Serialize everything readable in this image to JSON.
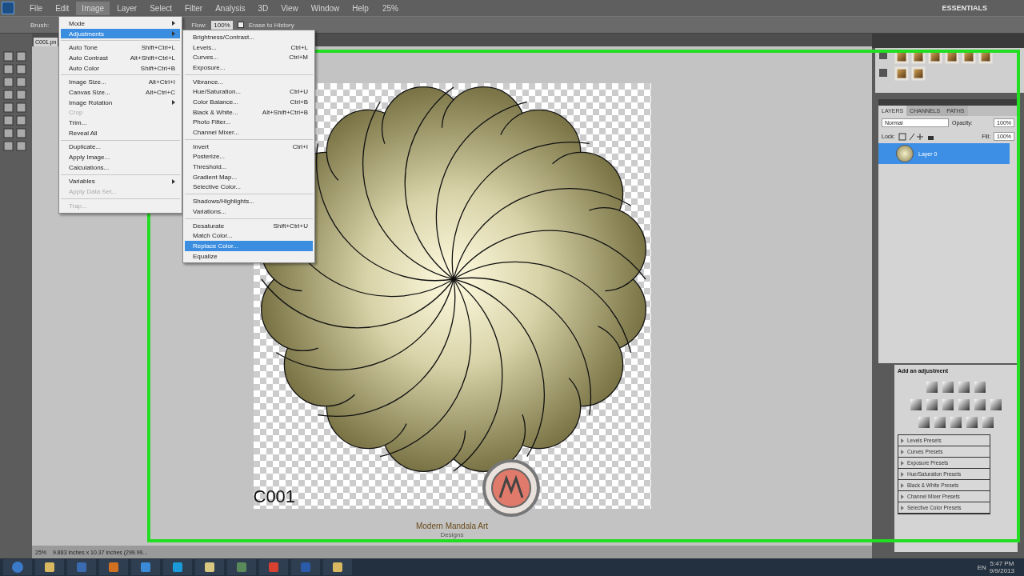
{
  "menu_bar": {
    "items": [
      {
        "label": "File",
        "selected": false
      },
      {
        "label": "Edit",
        "selected": false
      },
      {
        "label": "Image",
        "selected": true
      },
      {
        "label": "Layer",
        "selected": false
      },
      {
        "label": "Select",
        "selected": false
      },
      {
        "label": "Filter",
        "selected": false
      },
      {
        "label": "Analysis",
        "selected": false
      },
      {
        "label": "3D",
        "selected": false
      },
      {
        "label": "View",
        "selected": false
      },
      {
        "label": "Window",
        "selected": false
      },
      {
        "label": "Help",
        "selected": false
      }
    ],
    "zoom": "25%",
    "workspace": "ESSENTIALS"
  },
  "options_bar": {
    "brush_label": "Brush:",
    "flow_label": "Flow:",
    "flow_value": "100%",
    "erase_to_history": "Erase to History",
    "erase_to_history_checked": false
  },
  "image_menu": [
    {
      "kind": "submenu",
      "label": "Mode",
      "selected": false,
      "disabled": false
    },
    {
      "kind": "submenu",
      "label": "Adjustments",
      "selected": true,
      "disabled": false
    },
    {
      "kind": "separator"
    },
    {
      "kind": "item",
      "label": "Auto Tone",
      "shortcut": "Shift+Ctrl+L",
      "selected": false,
      "disabled": false
    },
    {
      "kind": "item",
      "label": "Auto Contrast",
      "shortcut": "Alt+Shift+Ctrl+L",
      "selected": false,
      "disabled": false
    },
    {
      "kind": "item",
      "label": "Auto Color",
      "shortcut": "Shift+Ctrl+B",
      "selected": false,
      "disabled": false
    },
    {
      "kind": "separator"
    },
    {
      "kind": "item",
      "label": "Image Size...",
      "shortcut": "Alt+Ctrl+I",
      "selected": false,
      "disabled": false
    },
    {
      "kind": "item",
      "label": "Canvas Size...",
      "shortcut": "Alt+Ctrl+C",
      "selected": false,
      "disabled": false
    },
    {
      "kind": "submenu",
      "label": "Image Rotation",
      "selected": false,
      "disabled": false
    },
    {
      "kind": "item",
      "label": "Crop",
      "selected": false,
      "disabled": true
    },
    {
      "kind": "item",
      "label": "Trim...",
      "selected": false,
      "disabled": false
    },
    {
      "kind": "item",
      "label": "Reveal All",
      "selected": false,
      "disabled": false
    },
    {
      "kind": "separator"
    },
    {
      "kind": "item",
      "label": "Duplicate...",
      "selected": false,
      "disabled": false
    },
    {
      "kind": "item",
      "label": "Apply Image...",
      "selected": false,
      "disabled": false
    },
    {
      "kind": "item",
      "label": "Calculations...",
      "selected": false,
      "disabled": false
    },
    {
      "kind": "separator"
    },
    {
      "kind": "submenu",
      "label": "Variables",
      "selected": false,
      "disabled": false
    },
    {
      "kind": "item",
      "label": "Apply Data Set...",
      "selected": false,
      "disabled": true
    },
    {
      "kind": "separator"
    },
    {
      "kind": "item",
      "label": "Trap...",
      "selected": false,
      "disabled": true
    }
  ],
  "adjustments_menu": [
    {
      "kind": "item",
      "label": "Brightness/Contrast...",
      "selected": false
    },
    {
      "kind": "item",
      "label": "Levels...",
      "shortcut": "Ctrl+L",
      "selected": false
    },
    {
      "kind": "item",
      "label": "Curves...",
      "shortcut": "Ctrl+M",
      "selected": false
    },
    {
      "kind": "item",
      "label": "Exposure...",
      "selected": false
    },
    {
      "kind": "separator"
    },
    {
      "kind": "item",
      "label": "Vibrance...",
      "selected": false
    },
    {
      "kind": "item",
      "label": "Hue/Saturation...",
      "shortcut": "Ctrl+U",
      "selected": false
    },
    {
      "kind": "item",
      "label": "Color Balance...",
      "shortcut": "Ctrl+B",
      "selected": false
    },
    {
      "kind": "item",
      "label": "Black & White...",
      "shortcut": "Alt+Shift+Ctrl+B",
      "selected": false
    },
    {
      "kind": "item",
      "label": "Photo Filter...",
      "selected": false
    },
    {
      "kind": "item",
      "label": "Channel Mixer...",
      "selected": false
    },
    {
      "kind": "separator"
    },
    {
      "kind": "item",
      "label": "Invert",
      "shortcut": "Ctrl+I",
      "selected": false
    },
    {
      "kind": "item",
      "label": "Posterize...",
      "selected": false
    },
    {
      "kind": "item",
      "label": "Threshold...",
      "selected": false
    },
    {
      "kind": "item",
      "label": "Gradient Map...",
      "selected": false
    },
    {
      "kind": "item",
      "label": "Selective Color...",
      "selected": false
    },
    {
      "kind": "separator"
    },
    {
      "kind": "item",
      "label": "Shadows/Highlights...",
      "selected": false
    },
    {
      "kind": "item",
      "label": "Variations...",
      "selected": false
    },
    {
      "kind": "separator"
    },
    {
      "kind": "item",
      "label": "Desaturate",
      "shortcut": "Shift+Ctrl+U",
      "selected": false
    },
    {
      "kind": "item",
      "label": "Match Color...",
      "selected": false
    },
    {
      "kind": "item",
      "label": "Replace Color...",
      "selected": true
    },
    {
      "kind": "item",
      "label": "Equalize",
      "selected": false
    }
  ],
  "document": {
    "tab": "C001.pn",
    "canvas_label": "C001",
    "logo_text": "Modern Mandala Art",
    "logo_subtext": "Designs",
    "status_zoom": "25%",
    "status_info": "9.883 inches x 10.37 inches (299.99..."
  },
  "layers_panel": {
    "tabs": [
      {
        "label": "LAYERS",
        "selected": true
      },
      {
        "label": "CHANNELS",
        "selected": false
      },
      {
        "label": "PATHS",
        "selected": false
      }
    ],
    "blend_mode": "Normal",
    "opacity_label": "Opacity:",
    "opacity": "100%",
    "lock_label": "Lock:",
    "fill_label": "Fill:",
    "fill": "100%",
    "layers": [
      {
        "name": "Layer 0",
        "selected": true
      }
    ]
  },
  "adjustments_panel": {
    "title": "Add an adjustment",
    "presets": [
      "Levels Presets",
      "Curves Presets",
      "Exposure Presets",
      "Hue/Saturation Presets",
      "Black & White Presets",
      "Channel Mixer Presets",
      "Selective Color Presets"
    ]
  },
  "taskbar": {
    "language": "EN",
    "time": "5:47 PM",
    "date": "9/9/2013"
  }
}
